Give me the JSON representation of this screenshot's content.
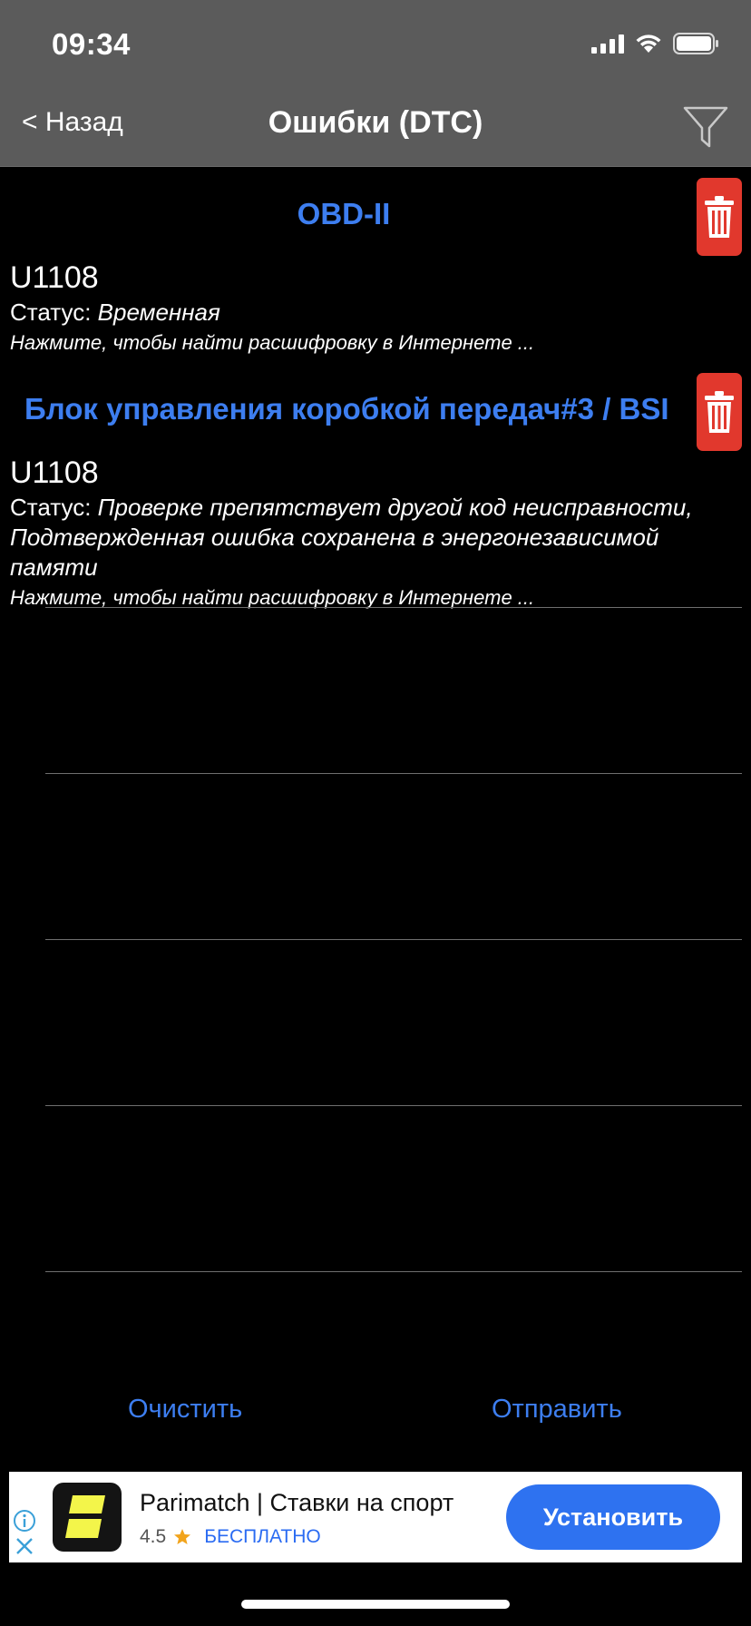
{
  "status_bar": {
    "time": "09:34"
  },
  "nav": {
    "back_label": "< Назад",
    "title": "Ошибки (DTC)"
  },
  "sections": [
    {
      "header": "OBD-II",
      "code": "U1108",
      "status_label": "Статус:",
      "status_value": "Временная",
      "hint": "Нажмите, чтобы найти расшифровку в Интернете ..."
    },
    {
      "header": "Блок управления коробкой передач#3 / BSI",
      "code": "U1108",
      "status_label": "Статус:",
      "status_value": "Проверке препятствует другой код неисправности, Подтвержденная ошибка сохранена в энергонезависимой памяти",
      "hint": "Нажмите, чтобы найти расшифровку в Интернете ..."
    }
  ],
  "actions": {
    "clear_label": "Очистить",
    "send_label": "Отправить"
  },
  "ad": {
    "title": "Parimatch | Ставки на спорт",
    "rating": "4.5",
    "price": "БЕСПЛАТНО",
    "install_label": "Установить"
  },
  "colors": {
    "accent": "#3d7ef0",
    "trash": "#e1382d",
    "topbar": "#5b5b5b",
    "ad_button": "#2e72f0",
    "ad_logo_yellow": "#f3f54a"
  }
}
